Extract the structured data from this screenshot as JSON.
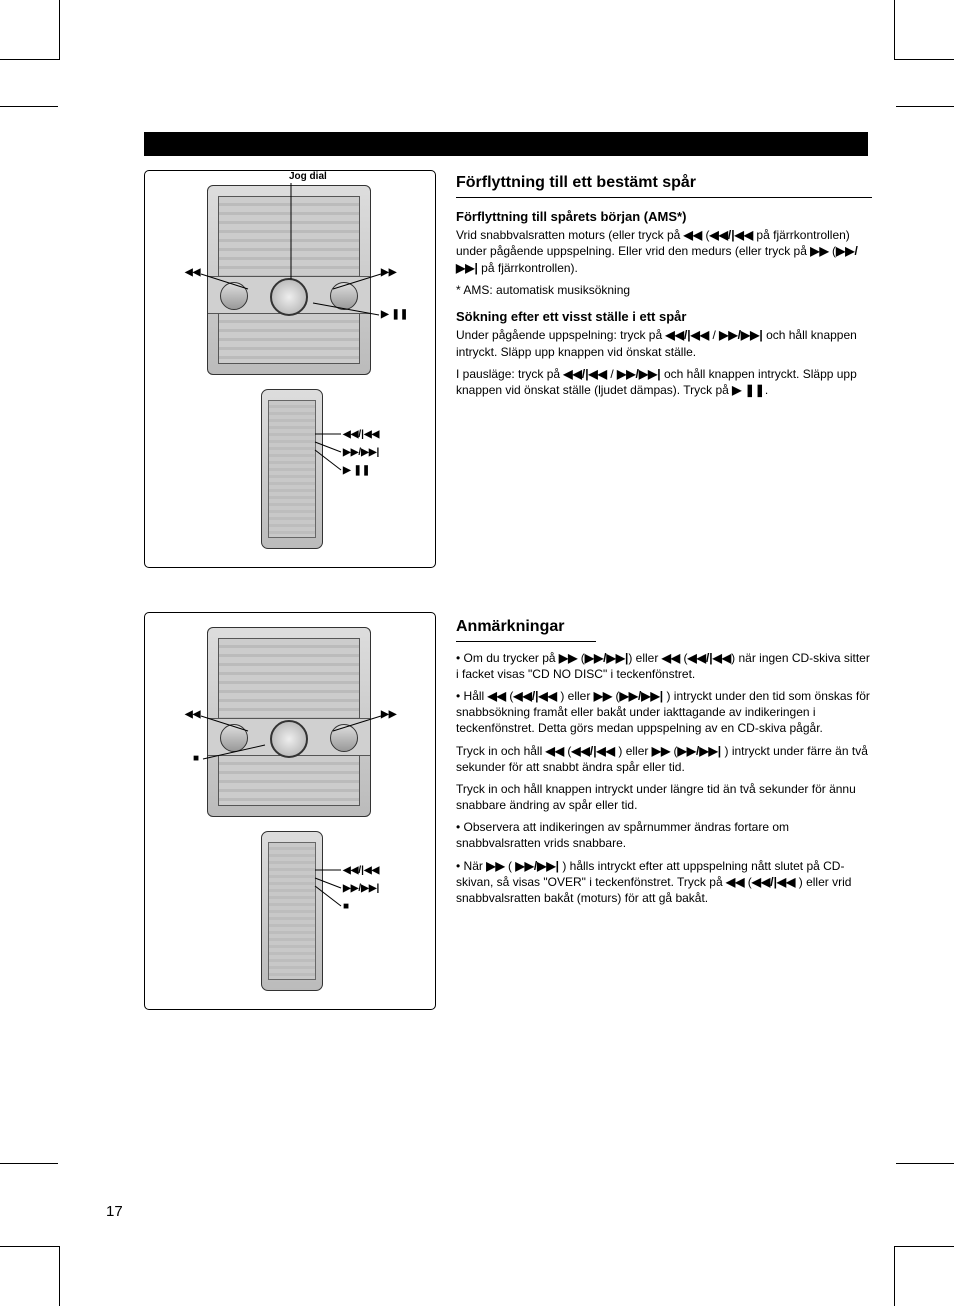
{
  "page_number": "17",
  "glyphs": {
    "rew": "◀◀",
    "ff": "▶▶",
    "prev": "|◀◀",
    "next": "▶▶|",
    "rew_prev": "◀◀/|◀◀",
    "ff_next": "▶▶/▶▶|",
    "play_pause": "▶ ❚❚",
    "stop": "■"
  },
  "fig1": {
    "label_rew": "◀◀",
    "label_ff": "▶▶",
    "label_play_pause": "▶ ❚❚",
    "label_jog": "Jog dial",
    "remote_rew_prev": "◀◀/|◀◀",
    "remote_ff_next": "▶▶/▶▶|",
    "remote_play_pause": "▶ ❚❚"
  },
  "fig2": {
    "label_rew": "◀◀",
    "label_ff": "▶▶",
    "label_stop": "■",
    "remote_rew_prev": "◀◀/|◀◀",
    "remote_ff_next": "▶▶/▶▶|",
    "remote_stop": "■"
  },
  "section1": {
    "title": "Förflyttning till ett bestämt spår",
    "sub_a": "Förflyttning till spårets början (AMS*)",
    "body_a1": "Vrid snabbvalsratten moturs (eller tryck på",
    "body_a2": " på fjärrkontrollen) under pågående uppspelning.",
    "body_a3": "Eller vrid den medurs (eller tryck på",
    "body_a4": " på fjärrkontrollen).",
    "body_a5": "* AMS: automatisk musiksökning",
    "sub_b": "Sökning efter ett visst ställe i ett spår",
    "body_b1": "Under pågående uppspelning: tryck på",
    "body_b2": " och håll knappen intryckt. Släpp upp knappen vid önskat ställe.",
    "body_b3": "I pausläge: tryck på",
    "body_b4": " och håll knappen intryckt. Släpp upp knappen vid önskat ställe (ljudet dämpas). Tryck på"
  },
  "section2": {
    "title": "Anmärkningar",
    "body1_a": "• Om du trycker på",
    "body1_b": " eller",
    "body1_c": " när ingen CD-skiva sitter i facket visas \"CD NO DISC\" i teckenfönstret.",
    "body2_a": "• Håll",
    "body2_b": ") eller",
    "body2_c": ") intryckt under den tid som önskas för snabbsökning framåt eller bakåt under iakttagande av indikeringen i teckenfönstret. Detta görs medan uppspelning av en CD-skiva pågår.",
    "body3_a": "Tryck in och håll",
    "body3_b": ") eller",
    "body3_c": ") intryckt under färre än två sekunder för att snabbt ändra spår eller tid.",
    "body4_a": "Tryck in och håll knappen intryckt under längre tid än två sekunder för ännu snabbare ändring av spår eller tid.",
    "body5_a": "• Observera att indikeringen av spårnummer ändras fortare om snabbvalsratten vrids snabbare.",
    "body6_a": "• När",
    "body6_b": " (",
    "body6_c": ") hålls intryckt efter att uppspelning nått slutet på CD-skivan, så visas \"OVER\" i teckenfönstret. Tryck på",
    "body6_d": ") eller vrid snabbvalsratten bakåt (moturs) för att gå bakåt."
  }
}
